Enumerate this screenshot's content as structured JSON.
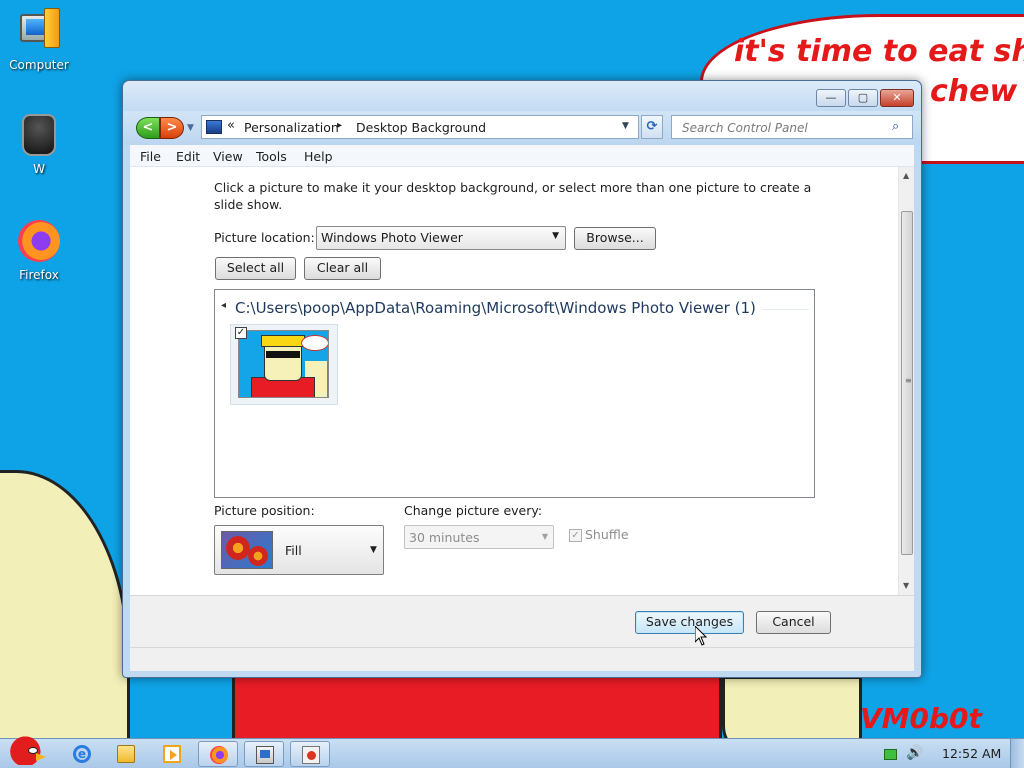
{
  "wallpaper": {
    "line1": "it's time to eat shit",
    "line2": "chew",
    "signature": "VM0b0t"
  },
  "desktop_icons": [
    {
      "label": "Computer",
      "icon": "computer-icon"
    },
    {
      "label": "W",
      "icon": "recycle-bin-icon"
    },
    {
      "label": "Firefox",
      "icon": "firefox-icon"
    }
  ],
  "window": {
    "nav": {
      "back": "<",
      "forward": ">",
      "history": "▼"
    },
    "address": {
      "chevron": "«",
      "crumbs": [
        "Personalization",
        "Desktop Background"
      ],
      "separator": "▸",
      "dropdown": "▼"
    },
    "refresh": "⟳",
    "search": {
      "placeholder": "Search Control Panel",
      "icon": "⌕"
    },
    "caption": {
      "minimize": "—",
      "maximize": "▢",
      "close": "✕"
    },
    "menu": [
      "File",
      "Edit",
      "View",
      "Tools",
      "Help"
    ]
  },
  "content": {
    "description": "Click a picture to make it your desktop background, or select more than one picture to create a slide show.",
    "picture_location_label": "Picture location:",
    "picture_location_value": "Windows Photo Viewer",
    "browse_label": "Browse...",
    "select_all_label": "Select all",
    "clear_all_label": "Clear all",
    "group_header": "C:\\Users\\poop\\AppData\\Roaming\\Microsoft\\Windows Photo Viewer (1)",
    "thumbnail_checked": true,
    "picture_position_label": "Picture position:",
    "picture_position_value": "Fill",
    "change_picture_label": "Change picture every:",
    "change_picture_value": "30 minutes",
    "shuffle_label": "Shuffle",
    "shuffle_checked": true,
    "save_label": "Save changes",
    "cancel_label": "Cancel"
  },
  "taskbar": {
    "items": [
      "internet-explorer-icon",
      "folder-icon",
      "media-player-icon",
      "firefox-icon",
      "control-panel-icon",
      "paint-icon"
    ],
    "clock": "12:52 AM"
  },
  "colors": {
    "wallpaper_blue": "#0ea3e6",
    "wallpaper_red": "#e41a1a",
    "window_frame": "#bfd9f3",
    "taskbar": "#b9d2ec"
  }
}
